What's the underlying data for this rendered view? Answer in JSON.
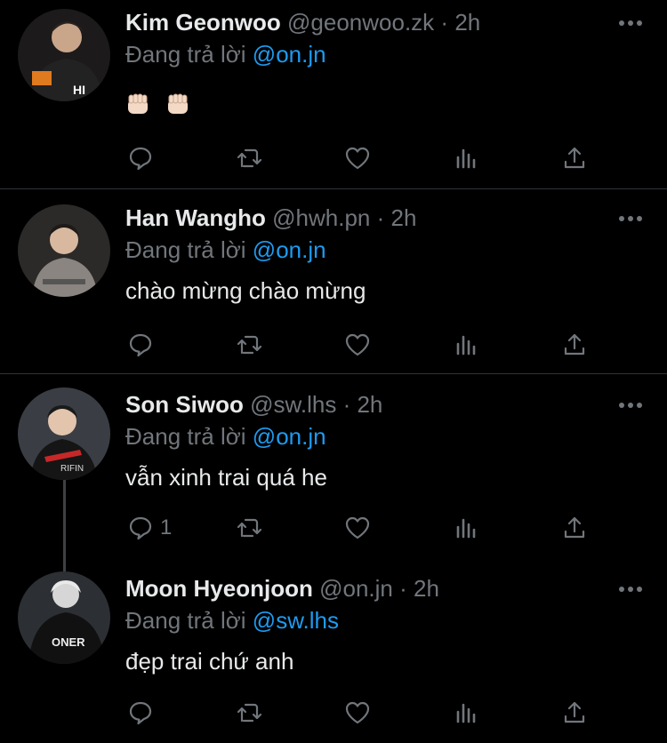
{
  "colors": {
    "background": "#000000",
    "text": "#e7e9ea",
    "muted": "#71767b",
    "link": "#1d9bf0",
    "divider": "#2f3336"
  },
  "tweets": [
    {
      "name": "Kim Geonwoo",
      "handle": "@geonwoo.zk",
      "dot": "·",
      "time": "2h",
      "reply_prefix": "Đang trả lời",
      "reply_to": "@on.jn",
      "text": "",
      "emoji": [
        "raised-fist-emoji",
        "raised-fist-emoji"
      ],
      "reply_count": ""
    },
    {
      "name": "Han Wangho",
      "handle": "@hwh.pn",
      "dot": "·",
      "time": "2h",
      "reply_prefix": "Đang trả lời",
      "reply_to": "@on.jn",
      "text": "chào mừng chào mừng",
      "reply_count": ""
    },
    {
      "name": "Son Siwoo",
      "handle": "@sw.lhs",
      "dot": "·",
      "time": "2h",
      "reply_prefix": "Đang trả lời",
      "reply_to": "@on.jn",
      "text": "vẫn xinh trai quá he",
      "reply_count": "1"
    },
    {
      "name": "Moon Hyeonjoon",
      "handle": "@on.jn",
      "dot": "·",
      "time": "2h",
      "reply_prefix": "Đang trả lời",
      "reply_to": "@sw.lhs",
      "text": "đẹp trai chứ anh",
      "reply_count": ""
    }
  ],
  "icons": [
    "reply-icon",
    "retweet-icon",
    "like-icon",
    "analytics-icon",
    "share-icon",
    "more-icon"
  ]
}
